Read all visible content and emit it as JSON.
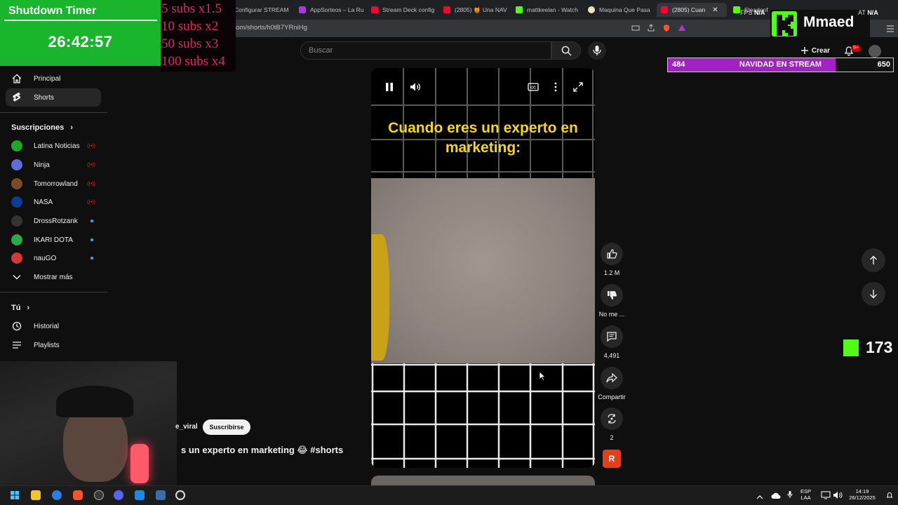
{
  "browser": {
    "tabs": [
      {
        "label": "Configurar STREAM",
        "color": "#1a73e8"
      },
      {
        "label": "AppSorteos – La Ru",
        "color": "#a33bd9"
      },
      {
        "label": "Stream Deck config",
        "color": "#ff0033"
      },
      {
        "label": "(2805) 🍯 Una NAV",
        "color": "#ff0033"
      },
      {
        "label": "mattkeelan - Watch",
        "color": "#53fc18"
      },
      {
        "label": "Maquina Que Pasa",
        "color": "#e9e4c2"
      },
      {
        "label": "(2805) Cuan",
        "color": "#ff0033"
      },
      {
        "label": "Eleadenfe",
        "color": "#53fc18"
      }
    ],
    "url": "om/shorts/h0tB7YRniHg"
  },
  "overlay": {
    "timer_title": "Shutdown Timer",
    "timer_time": "26:42:57",
    "subs_multipliers": [
      "5 subs x1.5",
      "10 subs x2",
      "50 subs x3",
      "100 subs x4"
    ],
    "logo_text": "Mmaed",
    "goal": {
      "left": "484",
      "title": "NAVIDAD EN STREAM",
      "right": "650",
      "progress": 0.745
    },
    "kick_viewers": "173",
    "fps_label": "FPS",
    "fps_value": "N/A",
    "cpu_label": "AT",
    "cpu_value": "N/A"
  },
  "header": {
    "search_placeholder": "Buscar",
    "create_label": "Crear",
    "notif_badge": "9+"
  },
  "sidebar": {
    "main": [
      {
        "label": "Principal",
        "icon": "home-icon"
      },
      {
        "label": "Shorts",
        "icon": "shorts-icon"
      }
    ],
    "subs_title": "Suscripciones",
    "subscriptions": [
      {
        "label": "Latina Noticias",
        "color": "#22a52b",
        "status": "live"
      },
      {
        "label": "Ninja",
        "color": "#5c6fd6",
        "status": "live"
      },
      {
        "label": "Tomorrowland",
        "color": "#7a4a2b",
        "status": "live"
      },
      {
        "label": "NASA",
        "color": "#0b3d91",
        "status": "live"
      },
      {
        "label": "DrossRotzank",
        "color": "#333333",
        "status": "new"
      },
      {
        "label": "IKARI DOTA",
        "color": "#2aa84a",
        "status": "new"
      },
      {
        "label": "nauGO",
        "color": "#d23a3a",
        "status": "new"
      }
    ],
    "show_more": "Mostrar más",
    "you_title": "Tú",
    "you_items": [
      {
        "label": "Historial",
        "icon": "history-icon"
      },
      {
        "label": "Playlists",
        "icon": "playlists-icon"
      }
    ]
  },
  "video": {
    "caption": "Cuando eres un experto en marketing:",
    "channel": "e_viral",
    "subscribe_label": "Suscribirse",
    "title": "s un experto en marketing 😂 #shorts"
  },
  "actions": {
    "likes": "1.2 M",
    "dislike": "No me ...",
    "comments": "4,491",
    "share": "Compartir",
    "remix": "2",
    "sound_badge": "R"
  },
  "taskbar": {
    "lang_1": "ESP",
    "lang_2": "LAA",
    "time": "14:19",
    "date": "26/12/2025"
  }
}
